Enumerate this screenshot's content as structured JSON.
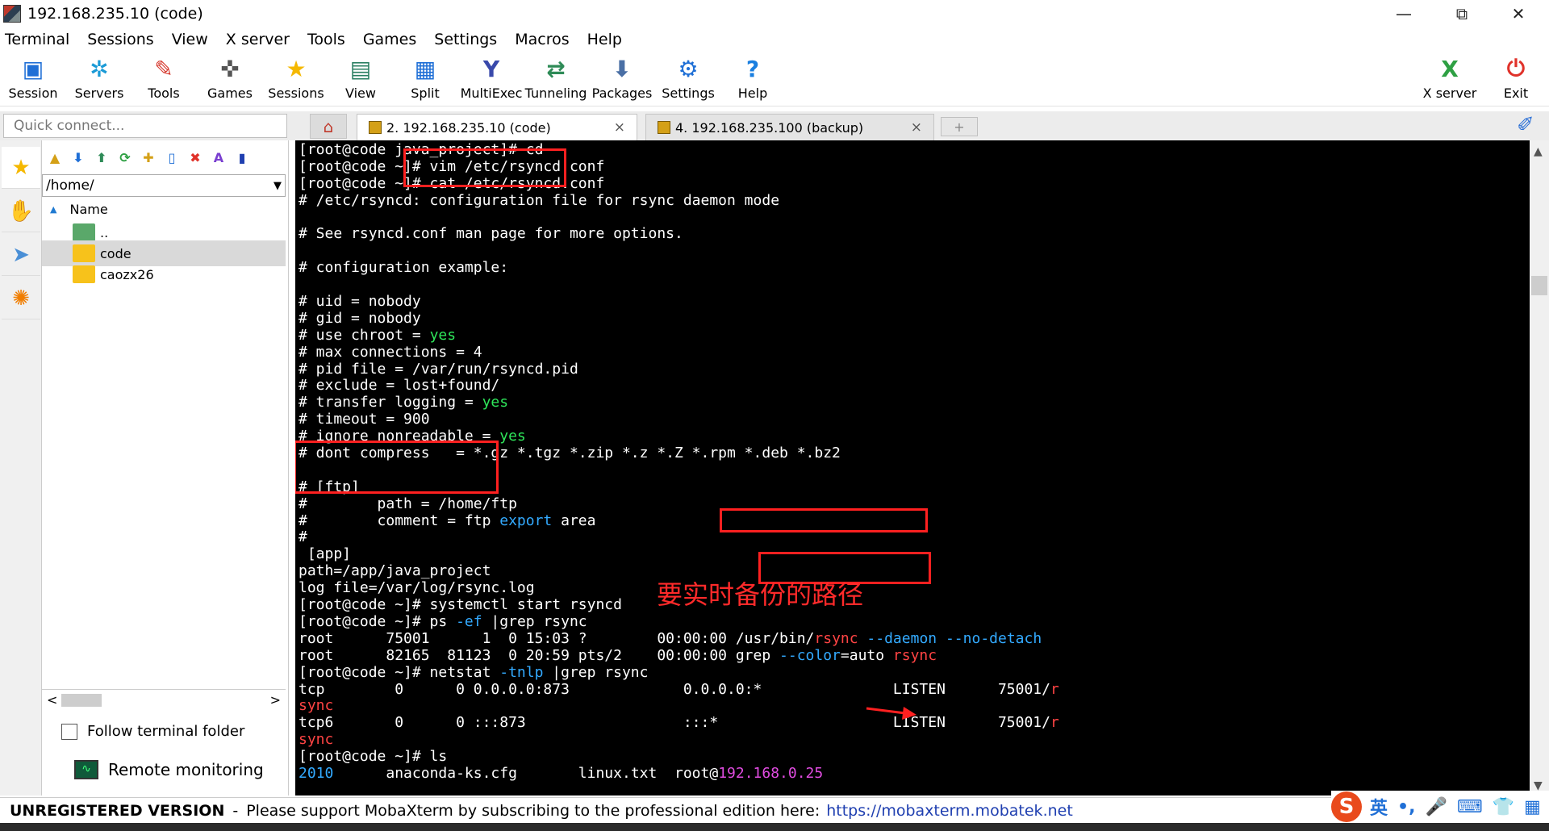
{
  "window": {
    "title": "192.168.235.10 (code)",
    "minimize": "—",
    "maximize": "⧉",
    "close": "✕"
  },
  "menu": [
    "Terminal",
    "Sessions",
    "View",
    "X server",
    "Tools",
    "Games",
    "Settings",
    "Macros",
    "Help"
  ],
  "toolbar": [
    {
      "label": "Session",
      "icon": "session-icon",
      "color": "#1f6fd6",
      "glyph": "▣"
    },
    {
      "label": "Servers",
      "icon": "servers-icon",
      "color": "#1a9ad6",
      "glyph": "✲"
    },
    {
      "label": "Tools",
      "icon": "tools-icon",
      "color": "#d63a2f",
      "glyph": "✎"
    },
    {
      "label": "Games",
      "icon": "games-icon",
      "color": "#555555",
      "glyph": "✜"
    },
    {
      "label": "Sessions",
      "icon": "sessions-star-icon",
      "color": "#f5b800",
      "glyph": "★"
    },
    {
      "label": "View",
      "icon": "view-icon",
      "color": "#2a7f62",
      "glyph": "▤"
    },
    {
      "label": "Split",
      "icon": "split-icon",
      "color": "#1f6fd6",
      "glyph": "▦"
    },
    {
      "label": "MultiExec",
      "icon": "multiexec-icon",
      "color": "#3949ab",
      "glyph": "Y"
    },
    {
      "label": "Tunneling",
      "icon": "tunneling-icon",
      "color": "#2e8b57",
      "glyph": "⇄"
    },
    {
      "label": "Packages",
      "icon": "packages-icon",
      "color": "#4a6fa5",
      "glyph": "⬇"
    },
    {
      "label": "Settings",
      "icon": "settings-gear-icon",
      "color": "#1f6fd6",
      "glyph": "⚙"
    },
    {
      "label": "Help",
      "icon": "help-icon",
      "color": "#1a7fe0",
      "glyph": "?"
    }
  ],
  "toolbar_right": [
    {
      "label": "X server",
      "icon": "x-server-icon",
      "color": "#2ea043",
      "glyph": "X"
    },
    {
      "label": "Exit",
      "icon": "exit-power-icon",
      "color": "#e0322a",
      "glyph": "⏻"
    }
  ],
  "quick_connect": {
    "placeholder": "Quick connect..."
  },
  "tabs": [
    {
      "label": "2. 192.168.235.10 (code)",
      "close": "×",
      "active": true
    },
    {
      "label": "4. 192.168.235.100 (backup)",
      "close": "×",
      "active": false
    }
  ],
  "new_tab": "+",
  "sidebar": {
    "path": "/home/",
    "column": "Name",
    "files": [
      {
        "name": "..",
        "type": "parent"
      },
      {
        "name": "code",
        "type": "folder",
        "selected": true
      },
      {
        "name": "caozx26",
        "type": "folder",
        "selected": false
      }
    ],
    "follow_label": "Follow terminal folder",
    "remote_label": "Remote monitoring",
    "scroll_left": "<",
    "scroll_right": ">"
  },
  "terminal": {
    "lines": [
      [
        {
          "t": "[root@code java_project]# cd"
        }
      ],
      [
        {
          "t": "[root@code ~]# vim /etc/rsyncd.conf"
        }
      ],
      [
        {
          "t": "[root@code ~]# cat /etc/rsyncd.conf"
        }
      ],
      [
        {
          "t": "# /etc/rsyncd: configuration file for rsync daemon mode"
        }
      ],
      [
        {
          "t": ""
        }
      ],
      [
        {
          "t": "# See rsyncd.conf man page for more options."
        }
      ],
      [
        {
          "t": ""
        }
      ],
      [
        {
          "t": "# configuration example:"
        }
      ],
      [
        {
          "t": ""
        }
      ],
      [
        {
          "t": "# uid = nobody"
        }
      ],
      [
        {
          "t": "# gid = nobody"
        }
      ],
      [
        {
          "t": "# use chroot = "
        },
        {
          "t": "yes",
          "c": "grn"
        }
      ],
      [
        {
          "t": "# max connections = 4"
        }
      ],
      [
        {
          "t": "# pid file = /var/run/rsyncd.pid"
        }
      ],
      [
        {
          "t": "# exclude = lost+found/"
        }
      ],
      [
        {
          "t": "# transfer logging = "
        },
        {
          "t": "yes",
          "c": "grn"
        }
      ],
      [
        {
          "t": "# timeout = 900"
        }
      ],
      [
        {
          "t": "# ignore nonreadable = "
        },
        {
          "t": "yes",
          "c": "grn"
        }
      ],
      [
        {
          "t": "# dont compress   = *.gz *.tgz *.zip *.z *.Z *.rpm *.deb *.bz2"
        }
      ],
      [
        {
          "t": ""
        }
      ],
      [
        {
          "t": "# [ftp]"
        }
      ],
      [
        {
          "t": "#        path = /home/ftp"
        }
      ],
      [
        {
          "t": "#        comment = ftp "
        },
        {
          "t": "export",
          "c": "blu"
        },
        {
          "t": " area"
        }
      ],
      [
        {
          "t": "#"
        }
      ],
      [
        {
          "t": " [app]"
        }
      ],
      [
        {
          "t": "path=/app/java_project"
        }
      ],
      [
        {
          "t": "log file=/var/log/rsync.log"
        }
      ],
      [
        {
          "t": "[root@code ~]# systemctl start rsyncd"
        }
      ],
      [
        {
          "t": "[root@code ~]# ps "
        },
        {
          "t": "-ef",
          "c": "blu"
        },
        {
          "t": " |grep rsync"
        }
      ],
      [
        {
          "t": "root      75001      1  0 15:03 ?        00:00:00 /usr/bin/"
        },
        {
          "t": "rsync",
          "c": "red"
        },
        {
          "t": " "
        },
        {
          "t": "--daemon",
          "c": "blu"
        },
        {
          "t": " "
        },
        {
          "t": "--no-detach",
          "c": "blu"
        }
      ],
      [
        {
          "t": "root      82165  81123  0 20:59 pts/2    00:00:00 grep "
        },
        {
          "t": "--color",
          "c": "blu"
        },
        {
          "t": "=auto "
        },
        {
          "t": "rsync",
          "c": "red"
        }
      ],
      [
        {
          "t": "[root@code ~]# netstat "
        },
        {
          "t": "-tnlp",
          "c": "blu"
        },
        {
          "t": " |grep rsync"
        }
      ],
      [
        {
          "t": "tcp        0      0 0.0.0.0:873             0.0.0.0:*               LISTEN      75001/"
        },
        {
          "t": "r",
          "c": "red"
        }
      ],
      [
        {
          "t": "sync",
          "c": "red"
        }
      ],
      [
        {
          "t": "tcp6       0      0 :::873                  :::*                    LISTEN      75001/"
        },
        {
          "t": "r",
          "c": "red"
        }
      ],
      [
        {
          "t": "sync",
          "c": "red"
        }
      ],
      [
        {
          "t": "[root@code ~]# ls"
        }
      ],
      [
        {
          "t": "2010",
          "c": "blu"
        },
        {
          "t": "      anaconda-ks.cfg       linux.txt  root@"
        },
        {
          "t": "192.168.0.25",
          "c": "mag"
        }
      ]
    ]
  },
  "annotation": {
    "text": "要实时备份的路径"
  },
  "status": {
    "unregistered": "UNREGISTERED VERSION",
    "sep": "-",
    "message": "Please support MobaXterm by subscribing to the professional edition here:",
    "link": "https://mobaxterm.mobatek.net"
  },
  "ime": {
    "logo": "S",
    "lang": "英",
    "items": [
      "•,",
      "🎤",
      "⌨",
      "👕",
      "▦"
    ]
  }
}
